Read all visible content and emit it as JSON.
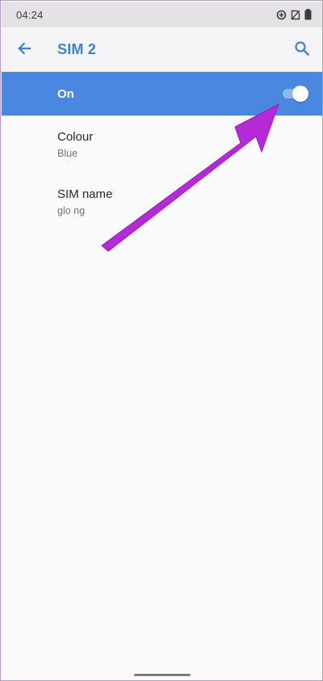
{
  "status_bar": {
    "time": "04:24",
    "icons": [
      "data-saver-icon",
      "no-sim-icon",
      "battery-icon"
    ]
  },
  "app_bar": {
    "title": "SIM 2",
    "back_icon": "arrow-left-icon",
    "search_icon": "search-icon",
    "accent": "#3b83d8"
  },
  "sim_toggle": {
    "label": "On",
    "enabled": true,
    "row_color": "#4a87e0"
  },
  "preferences": [
    {
      "title": "Colour",
      "summary": "Blue"
    },
    {
      "title": "SIM name",
      "summary": "glo ng"
    }
  ],
  "annotation": {
    "type": "arrow",
    "color": "#b52ad6",
    "points_to": "sim-toggle-switch"
  }
}
